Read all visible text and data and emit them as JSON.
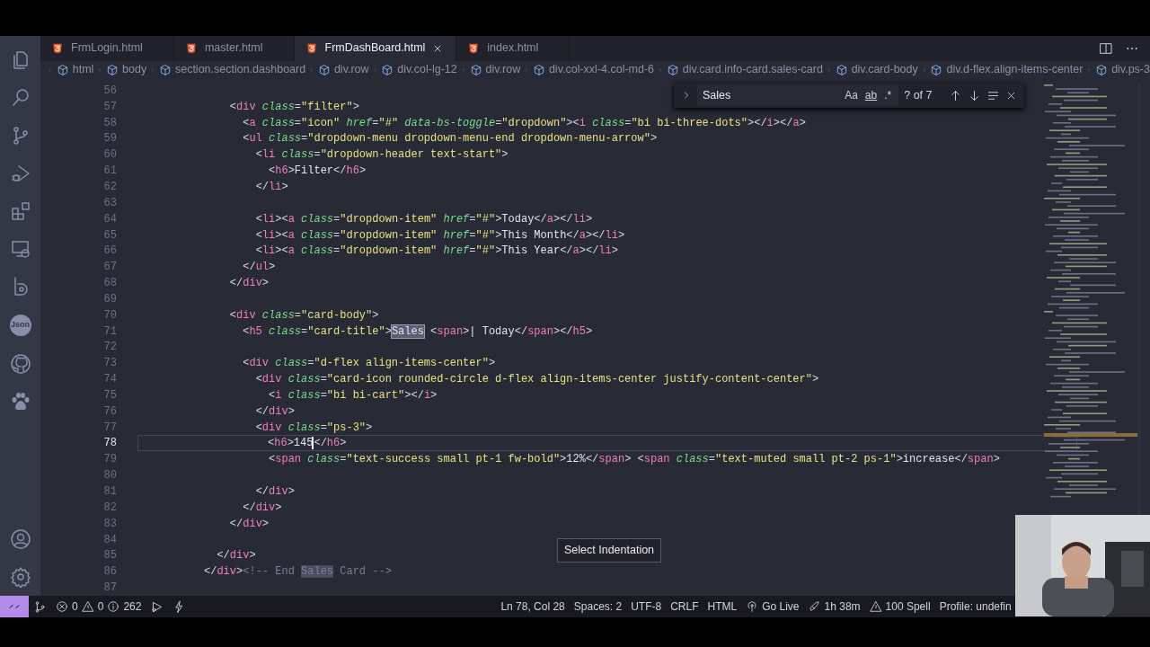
{
  "activity_bar": {
    "badge_text": "Json"
  },
  "tabs": [
    {
      "label": "FrmLogin.html",
      "selected": false
    },
    {
      "label": "master.html",
      "selected": false
    },
    {
      "label": "FrmDashBoard.html",
      "selected": true
    },
    {
      "label": "index.html",
      "selected": false
    }
  ],
  "breadcrumbs": [
    "html",
    "body",
    "section.section.dashboard",
    "div.row",
    "div.col-lg-12",
    "div.row",
    "div.col-xxl-4.col-md-6",
    "div.card.info-card.sales-card",
    "div.card-body",
    "div.d-flex.align-items-center",
    "div.ps-3"
  ],
  "find_widget": {
    "value": "Sales",
    "toggles": [
      "Aa",
      "ab",
      ".*"
    ],
    "result": "? of 7"
  },
  "editor": {
    "lines": [
      {
        "number": "56",
        "current": false
      },
      {
        "number": "57",
        "current": false,
        "segments": [
          {
            "kind": "code",
            "text": "              <div class=\"filter\">",
            "match": false
          }
        ]
      },
      {
        "number": "58",
        "current": false,
        "segments": [
          {
            "kind": "code",
            "text": "                <a class=\"icon\" href=\"#\" data-bs-toggle=\"dropdown\"><i class=\"bi bi-three-dots\"></i></a>",
            "match": false
          }
        ]
      },
      {
        "number": "59",
        "current": false,
        "segments": [
          {
            "kind": "code",
            "text": "                <ul class=\"dropdown-menu dropdown-menu-end dropdown-menu-arrow\">",
            "match": false
          }
        ]
      },
      {
        "number": "60",
        "current": false,
        "segments": [
          {
            "kind": "code",
            "text": "                  <li class=\"dropdown-header text-start\">",
            "match": false
          }
        ]
      },
      {
        "number": "61",
        "current": false,
        "segments": [
          {
            "kind": "code",
            "text": "                    <h6>Filter</h6>",
            "match": false
          }
        ]
      },
      {
        "number": "62",
        "current": false,
        "segments": [
          {
            "kind": "code",
            "text": "                  </li>",
            "match": false
          }
        ]
      },
      {
        "number": "63",
        "current": false
      },
      {
        "number": "64",
        "current": false,
        "segments": [
          {
            "kind": "code",
            "text": "                  <li><a class=\"dropdown-item\" href=\"#\">Today</a></li>",
            "match": false
          }
        ]
      },
      {
        "number": "65",
        "current": false,
        "segments": [
          {
            "kind": "code",
            "text": "                  <li><a class=\"dropdown-item\" href=\"#\">This Month</a></li>",
            "match": false
          }
        ]
      },
      {
        "number": "66",
        "current": false,
        "segments": [
          {
            "kind": "code",
            "text": "                  <li><a class=\"dropdown-item\" href=\"#\">This Year</a></li>",
            "match": false
          }
        ]
      },
      {
        "number": "67",
        "current": false,
        "segments": [
          {
            "kind": "code",
            "text": "                </ul>",
            "match": false
          }
        ]
      },
      {
        "number": "68",
        "current": false,
        "segments": [
          {
            "kind": "code",
            "text": "              </div>",
            "match": false
          }
        ]
      },
      {
        "number": "69",
        "current": false
      },
      {
        "number": "70",
        "current": false,
        "segments": [
          {
            "kind": "code",
            "text": "              <div class=\"card-body\">",
            "match": false
          }
        ]
      },
      {
        "number": "71",
        "current": false,
        "segments": [
          {
            "kind": "code",
            "text": "                <h5 class=\"card-title\">",
            "match": false
          },
          {
            "kind": "code",
            "text": "Sales",
            "match": true
          },
          {
            "kind": "code",
            "text": " <span>| Today</span></h5>",
            "match": false
          }
        ]
      },
      {
        "number": "72",
        "current": false
      },
      {
        "number": "73",
        "current": false,
        "segments": [
          {
            "kind": "code",
            "text": "                <div class=\"d-flex align-items-center\">",
            "match": false
          }
        ]
      },
      {
        "number": "74",
        "current": false,
        "segments": [
          {
            "kind": "code",
            "text": "                  <div class=\"card-icon rounded-circle d-flex align-items-center justify-content-center\">",
            "match": false
          }
        ]
      },
      {
        "number": "75",
        "current": false,
        "segments": [
          {
            "kind": "code",
            "text": "                    <i class=\"bi bi-cart\"></i>",
            "match": false
          }
        ]
      },
      {
        "number": "76",
        "current": false,
        "segments": [
          {
            "kind": "code",
            "text": "                  </div>",
            "match": false
          }
        ]
      },
      {
        "number": "77",
        "current": false,
        "segments": [
          {
            "kind": "code",
            "text": "                  <div class=\"ps-3\">",
            "match": false
          }
        ]
      },
      {
        "number": "78",
        "current": true,
        "segments": [
          {
            "kind": "code",
            "text": "                    <h6>145",
            "match": false,
            "caret": true
          },
          {
            "kind": "code",
            "text": "</h6>",
            "match": false,
            "caret": false
          }
        ]
      },
      {
        "number": "79",
        "current": false,
        "segments": [
          {
            "kind": "code",
            "text": "                    <span class=\"text-success small pt-1 fw-bold\">12%</span> <span class=\"text-muted small pt-2 ps-1\">increase</span>",
            "match": false
          }
        ]
      },
      {
        "number": "80",
        "current": false
      },
      {
        "number": "81",
        "current": false,
        "segments": [
          {
            "kind": "code",
            "text": "                  </div>",
            "match": false
          }
        ]
      },
      {
        "number": "82",
        "current": false,
        "segments": [
          {
            "kind": "code",
            "text": "                </div>",
            "match": false
          }
        ]
      },
      {
        "number": "83",
        "current": false,
        "segments": [
          {
            "kind": "code",
            "text": "              </div>",
            "match": false
          }
        ]
      },
      {
        "number": "84",
        "current": false
      },
      {
        "number": "85",
        "current": false,
        "segments": [
          {
            "kind": "code",
            "text": "            </div>",
            "match": false
          }
        ]
      },
      {
        "number": "86",
        "current": false,
        "segments": [
          {
            "kind": "code",
            "text": "          </div>",
            "match": false
          },
          {
            "kind": "comment",
            "text": "<!-- End ",
            "match": false
          },
          {
            "kind": "comment",
            "text": "Sales",
            "match": true
          },
          {
            "kind": "comment",
            "text": " Card -->",
            "match": false
          }
        ]
      },
      {
        "number": "87",
        "current": false
      }
    ]
  },
  "tooltip": "Select Indentation",
  "status_bar": {
    "errors": "0",
    "warnings": "0",
    "infos": "262",
    "right": [
      "Ln 78, Col 28",
      "Spaces: 2",
      "UTF-8",
      "CRLF",
      "HTML",
      "Go Live",
      "1h 38m",
      "100 Spell",
      "Profile: undefin"
    ]
  }
}
